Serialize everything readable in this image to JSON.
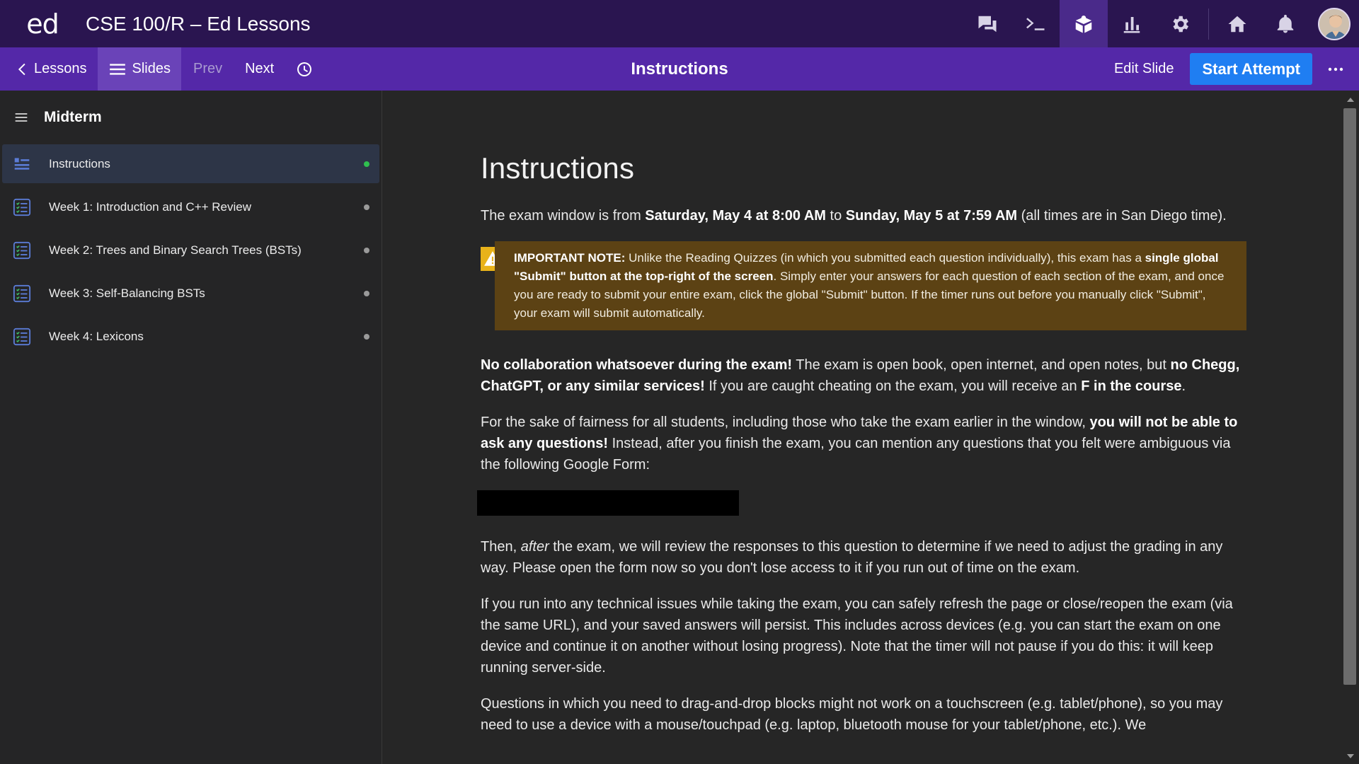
{
  "topbar": {
    "logo": "ed",
    "course_title": "CSE 100/R – Ed Lessons",
    "icons": [
      "discussion-icon",
      "terminal-icon",
      "lessons-icon",
      "analytics-icon",
      "settings-icon",
      "home-icon",
      "bell-icon"
    ],
    "active_icon": "lessons-icon"
  },
  "subbar": {
    "lessons_label": "Lessons",
    "slides_label": "Slides",
    "prev_label": "Prev",
    "next_label": "Next",
    "title": "Instructions",
    "edit_slide_label": "Edit Slide",
    "start_attempt_label": "Start Attempt"
  },
  "sidebar": {
    "title": "Midterm",
    "items": [
      {
        "label": "Instructions",
        "status": "done"
      },
      {
        "label": "Week 1: Introduction and C++ Review",
        "status": "pending"
      },
      {
        "label": "Week 2: Trees and Binary Search Trees (BSTs)",
        "status": "pending"
      },
      {
        "label": "Week 3: Self-Balancing BSTs",
        "status": "pending"
      },
      {
        "label": "Week 4: Lexicons",
        "status": "pending"
      }
    ]
  },
  "content": {
    "title": "Instructions",
    "p1": {
      "a": "The exam window is from ",
      "b1": "Saturday, May 4 at 8:00 AM",
      "c": " to ",
      "b2": "Sunday, May 5 at 7:59 AM",
      "d": " (all times are in San Diego time)."
    },
    "note": {
      "b1": "IMPORTANT NOTE:",
      "a": " Unlike the Reading Quizzes (in which you submitted each question individually), this exam has a ",
      "b2": "single global \"Submit\" button at the top-right of the screen",
      "c": ". Simply enter your answers for each question of each section of the exam, and once you are ready to submit your entire exam, click the global \"Submit\" button. If the timer runs out before you manually click \"Submit\", your exam will submit automatically."
    },
    "p2": {
      "b1": "No collaboration whatsoever during the exam!",
      "a": " The exam is open book, open internet, and open notes, but ",
      "b2": "no Chegg, ChatGPT, or any similar services!",
      "c": " If you are caught cheating on the exam, you will receive an ",
      "b3": "F in the course",
      "d": "."
    },
    "p3": {
      "a": "For the sake of fairness for all students, including those who take the exam earlier in the window, ",
      "b1": "you will not be able to ask any questions!",
      "c": " Instead, after you finish the exam, you can mention any questions that you felt were ambiguous via the following Google Form:"
    },
    "p4": {
      "a": "Then, ",
      "i1": "after",
      "c": " the exam, we will review the responses to this question to determine if we need to adjust the grading in any way. Please open the form now so you don't lose access to it if you run out of time on the exam."
    },
    "p5": "If you run into any technical issues while taking the exam, you can safely refresh the page or close/reopen the exam (via the same URL), and your saved answers will persist. This includes across devices (e.g. you can start the exam on one device and continue it on another without losing progress). Note that the timer will not pause if you do this: it will keep running server-side.",
    "p6": "Questions in which you need to drag-and-drop blocks might not work on a touchscreen (e.g. tablet/phone), so you may need to use a device with a mouse/touchpad (e.g. laptop, bluetooth mouse for your tablet/phone, etc.). We"
  },
  "colors": {
    "topbar": "#2a1550",
    "subbar": "#5428a8",
    "accent_button": "#1f7ef2",
    "note_background": "#5c4214",
    "warning_icon": "#e8b21a",
    "done_dot": "#2fbf4f"
  }
}
